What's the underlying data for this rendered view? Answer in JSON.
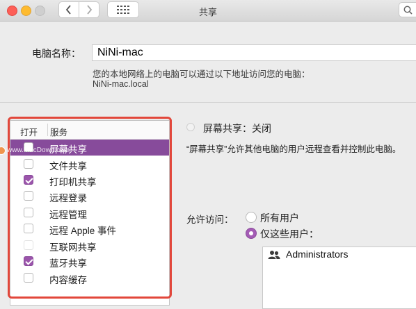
{
  "window": {
    "title": "共享"
  },
  "toolbar": {
    "back_icon": "chevron-left-icon",
    "forward_icon": "chevron-right-icon",
    "grid_icon": "grid-icon",
    "search_icon": "search-icon"
  },
  "computer_name": {
    "label": "电脑名称：",
    "value": "NiNi-mac",
    "hint": "您的本地网络上的电脑可以通过以下地址访问您的电脑：",
    "address": "NiNi-mac.local"
  },
  "services": {
    "header_open": "打开",
    "header_service": "服务",
    "items": [
      {
        "label": "屏幕共享",
        "checked": false,
        "selected": true
      },
      {
        "label": "文件共享",
        "checked": false,
        "selected": false
      },
      {
        "label": "打印机共享",
        "checked": true,
        "selected": false
      },
      {
        "label": "远程登录",
        "checked": false,
        "selected": false
      },
      {
        "label": "远程管理",
        "checked": false,
        "selected": false
      },
      {
        "label": "远程 Apple 事件",
        "checked": false,
        "selected": false
      },
      {
        "label": "互联网共享",
        "checked": false,
        "selected": false
      },
      {
        "label": "蓝牙共享",
        "checked": true,
        "selected": false
      },
      {
        "label": "内容缓存",
        "checked": false,
        "selected": false
      }
    ]
  },
  "detail": {
    "status": "屏幕共享：关闭",
    "description": "“屏幕共享”允许其他电脑的用户远程查看并控制此电脑。",
    "access_label": "允许访问：",
    "option_all": "所有用户",
    "option_some": "仅这些用户：",
    "selected_option": "some",
    "users": [
      "Administrators"
    ]
  },
  "watermark": "www.MacDown.com",
  "colors": {
    "selection": "#874b9b",
    "checkbox_on": "#9b55ab",
    "highlight_frame": "#e2473b"
  }
}
